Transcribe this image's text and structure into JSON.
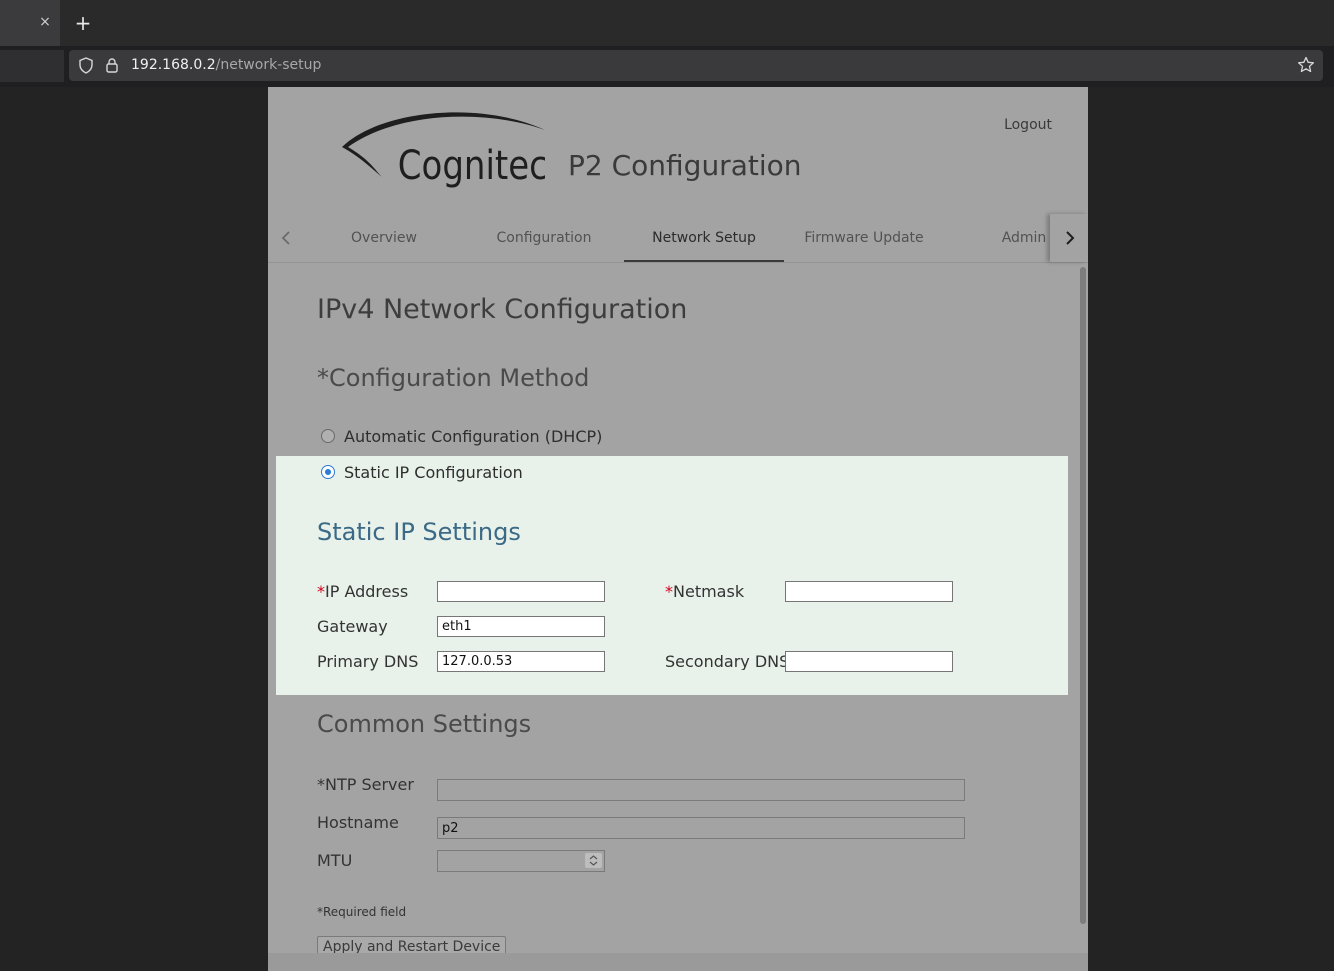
{
  "browser": {
    "tab_close": "×",
    "new_tab": "+",
    "url_host": "192.168.0.2",
    "url_path": "/network-setup"
  },
  "header": {
    "logo_text": "Cognitec",
    "title": "P2 Configuration",
    "logout": "Logout"
  },
  "nav_tabs": [
    {
      "label": "Overview"
    },
    {
      "label": "Configuration"
    },
    {
      "label": "Network Setup",
      "active": true
    },
    {
      "label": "Firmware Update"
    },
    {
      "label": "Admin"
    }
  ],
  "ipv4": {
    "title": "IPv4 Network Configuration",
    "method_title": "*Configuration Method",
    "options": [
      {
        "label": "Automatic Configuration (DHCP)",
        "checked": false
      },
      {
        "label": "Static IP Configuration",
        "checked": true
      }
    ],
    "static_title": "Static IP Settings",
    "fields": {
      "ip_label": "IP Address",
      "ip_value": "",
      "netmask_label": "Netmask",
      "netmask_value": "",
      "gateway_label": "Gateway",
      "gateway_value": "eth1",
      "primary_dns_label": "Primary DNS",
      "primary_dns_value": "127.0.0.53",
      "secondary_dns_label": "Secondary DNS",
      "secondary_dns_value": ""
    },
    "required_mark": "*"
  },
  "common": {
    "title": "Common Settings",
    "ntp_label": "*NTP Server",
    "ntp_value": "",
    "hostname_label": "Hostname",
    "hostname_value": "p2",
    "mtu_label": "MTU",
    "mtu_value": "",
    "required_note_mark": "*",
    "required_note": "Required field",
    "apply_button": "Apply and Restart Device"
  },
  "colors": {
    "required": "#d0021b",
    "static_panel_bg": "#e8f1ea",
    "static_title": "#3b6a86",
    "radio_accent": "#2a7bd4"
  }
}
